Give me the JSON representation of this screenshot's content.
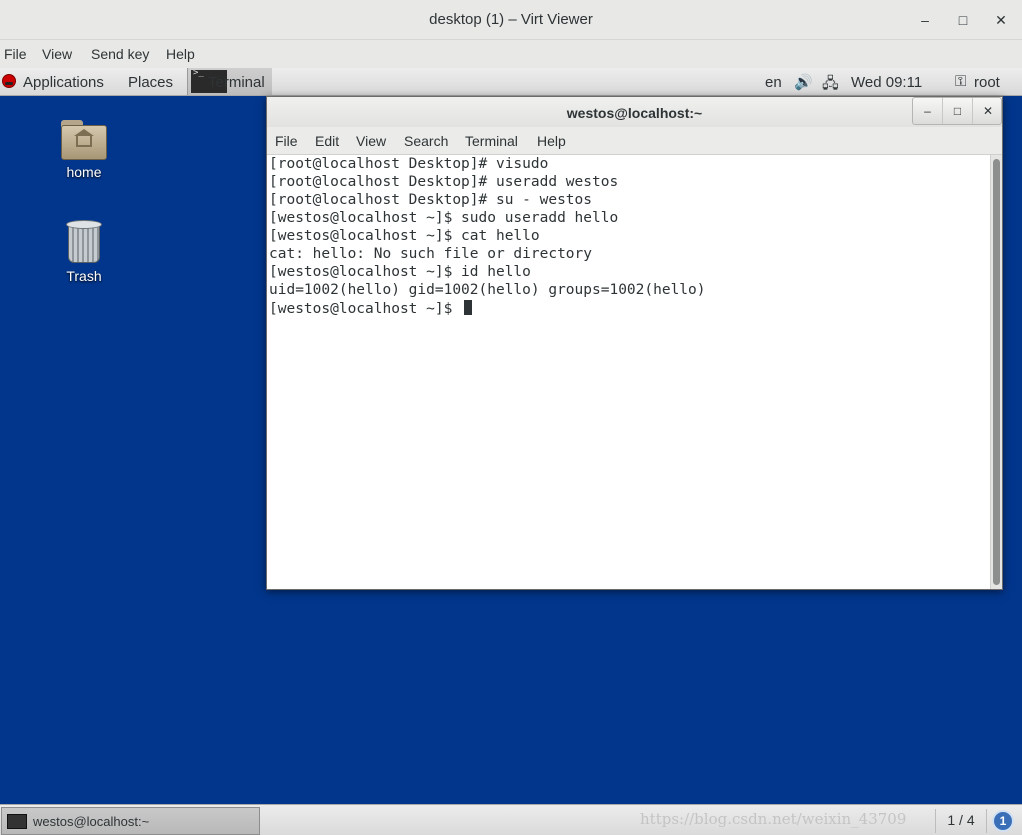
{
  "viewer": {
    "title": "desktop (1) – Virt Viewer",
    "minimize_glyph": "–",
    "maximize_glyph": "□",
    "close_glyph": "✕",
    "menu": [
      "File",
      "View",
      "Send key",
      "Help"
    ]
  },
  "top_panel": {
    "applications": "Applications",
    "places": "Places",
    "task_terminal": "Terminal",
    "keyboard_layout": "en",
    "clock": "Wed 09:11",
    "user": "root",
    "volume_icon": "volume-icon",
    "network_icon": "network-icon"
  },
  "desktop_icons": [
    {
      "label": "home",
      "icon": "home-folder-icon"
    },
    {
      "label": "Trash",
      "icon": "trash-icon"
    }
  ],
  "terminal": {
    "title": "westos@localhost:~",
    "menu": [
      "File",
      "Edit",
      "View",
      "Search",
      "Terminal",
      "Help"
    ],
    "lines": [
      "[root@localhost Desktop]# visudo",
      "[root@localhost Desktop]# useradd westos",
      "[root@localhost Desktop]# su - westos",
      "[westos@localhost ~]$ sudo useradd hello",
      "[westos@localhost ~]$ cat hello",
      "cat: hello: No such file or directory",
      "[westos@localhost ~]$ id hello",
      "uid=1002(hello) gid=1002(hello) groups=1002(hello)"
    ],
    "prompt": "[westos@localhost ~]$ "
  },
  "bottom_panel": {
    "task_label": "westos@localhost:~",
    "workspace": "1 / 4",
    "notifications": "1",
    "watermark": "https://blog.csdn.net/weixin_43709"
  }
}
